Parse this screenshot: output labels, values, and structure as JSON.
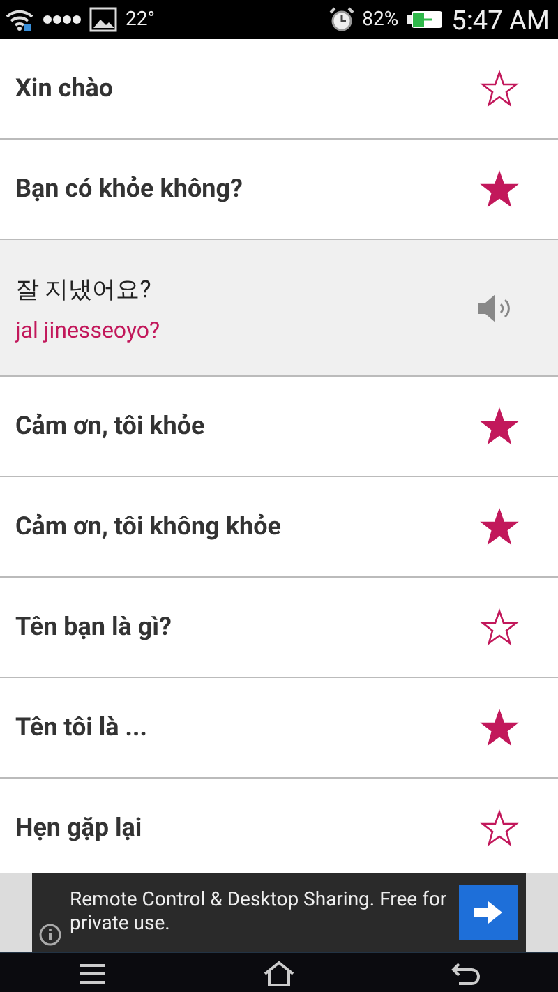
{
  "status_bar": {
    "temperature": "22°",
    "battery": "82%",
    "time": "5:47 AM"
  },
  "phrases": [
    {
      "kind": "phrase",
      "text": "Xin chào",
      "starred": false
    },
    {
      "kind": "phrase",
      "text": "Bạn có khỏe không?",
      "starred": true
    },
    {
      "kind": "expanded",
      "text": "잘 지냈어요?",
      "romanization": "jal jinesseoyo?"
    },
    {
      "kind": "phrase",
      "text": "Cảm ơn, tôi khỏe",
      "starred": true
    },
    {
      "kind": "phrase",
      "text": "Cảm ơn, tôi không khỏe",
      "starred": true
    },
    {
      "kind": "phrase",
      "text": "Tên bạn là gì?",
      "starred": false
    },
    {
      "kind": "phrase",
      "text": "Tên tôi là ...",
      "starred": true
    },
    {
      "kind": "phrase",
      "text": "Hẹn gặp lại",
      "starred": false
    }
  ],
  "ad": {
    "text": "Remote Control & Desktop Sharing. Free for private use."
  }
}
